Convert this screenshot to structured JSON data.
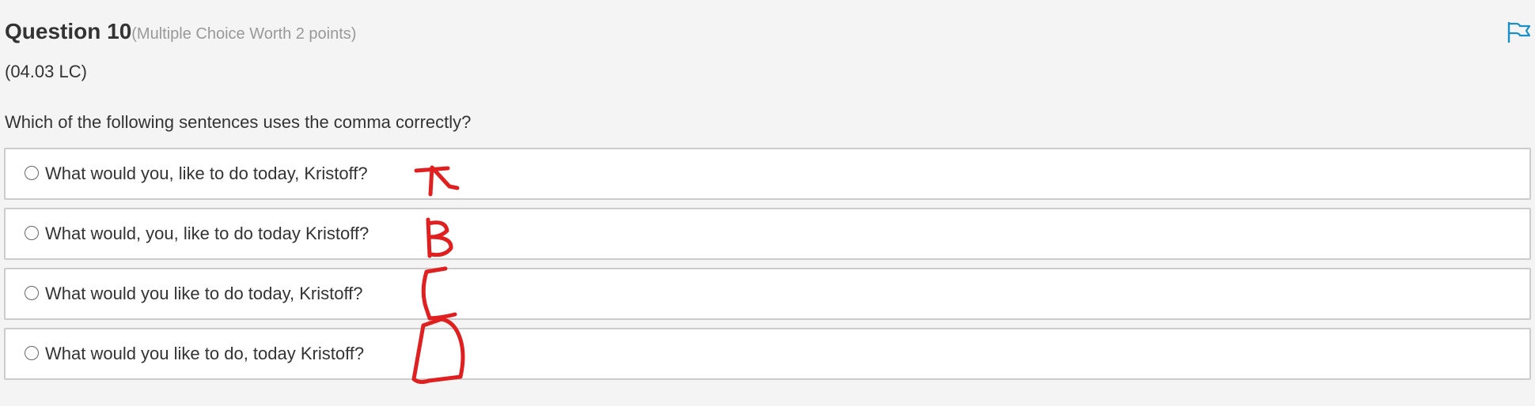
{
  "question": {
    "title": "Question 10",
    "meta": "(Multiple Choice Worth 2 points)",
    "code": "(04.03 LC)",
    "prompt": "Which of the following sentences uses the comma correctly?"
  },
  "options": [
    {
      "label": "What would you, like to do today, Kristoff?",
      "selected": false
    },
    {
      "label": "What would, you, like to do today Kristoff?",
      "selected": false
    },
    {
      "label": "What would you like to do today, Kristoff?",
      "selected": false
    },
    {
      "label": "What would you like to do, today Kristoff?",
      "selected": false
    }
  ],
  "icons": {
    "flag": "flag-icon",
    "radio": "radio-circle-icon"
  },
  "colors": {
    "background": "#f4f4f4",
    "flag": "#1a8fc7",
    "annotation": "#e02020"
  }
}
